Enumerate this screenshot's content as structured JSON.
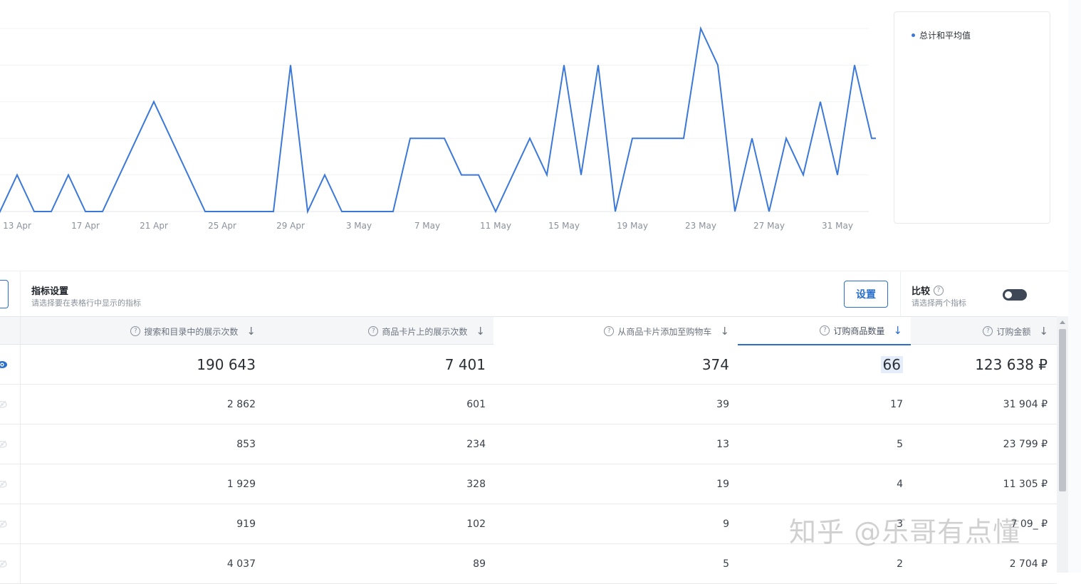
{
  "chart_data": {
    "type": "line",
    "x_labels": [
      "13 Apr",
      "17 Apr",
      "21 Apr",
      "25 Apr",
      "29 Apr",
      "3 May",
      "7 May",
      "11 May",
      "15 May",
      "19 May",
      "23 May",
      "27 May",
      "31 May"
    ],
    "series": [
      {
        "name": "总计和平均值",
        "values": [
          1,
          0,
          1,
          0,
          0,
          1,
          0,
          0,
          1,
          2,
          3,
          2,
          1,
          0,
          0,
          0,
          0,
          0,
          4,
          0,
          1,
          0,
          0,
          0,
          0,
          2,
          2,
          2,
          1,
          1,
          0,
          1,
          2,
          1,
          4,
          1,
          4,
          0,
          2,
          2,
          2,
          2,
          5,
          4,
          0,
          2,
          0,
          2,
          1,
          3,
          1,
          4,
          2,
          2,
          0,
          1,
          0
        ]
      }
    ],
    "ylim": [
      0,
      5
    ],
    "grid": true,
    "legend": "right"
  },
  "legend": {
    "label": "总计和平均值"
  },
  "toolbar": {
    "title": "指标设置",
    "subtitle": "请选择要在表格行中显示的指标",
    "settings_label": "设置",
    "compare_title": "比较",
    "compare_subtitle": "请选择两个指标",
    "help_glyph": "?",
    "compare_on": false
  },
  "table": {
    "columns": [
      "搜索和目录中的展示次数",
      "商品卡片上的展示次数",
      "从商品卡片添加至购物车",
      "订购商品数量",
      "订购金额"
    ],
    "sorted_column": 3,
    "total": [
      "190 643",
      "7 401",
      "374",
      "66",
      "123 638 ₽"
    ],
    "rows": [
      [
        "2 862",
        "601",
        "39",
        "17",
        "31 904 ₽"
      ],
      [
        "853",
        "234",
        "13",
        "5",
        "23 799 ₽"
      ],
      [
        "1 929",
        "328",
        "19",
        "4",
        "11 305 ₽"
      ],
      [
        "919",
        "102",
        "9",
        "3",
        "7 09_ ₽"
      ],
      [
        "4 037",
        "89",
        "5",
        "2",
        "2 704 ₽"
      ]
    ]
  },
  "watermark": "知乎 @乐哥有点懂",
  "colors": {
    "accent": "#2a6fc9",
    "line": "#3b78d8"
  }
}
